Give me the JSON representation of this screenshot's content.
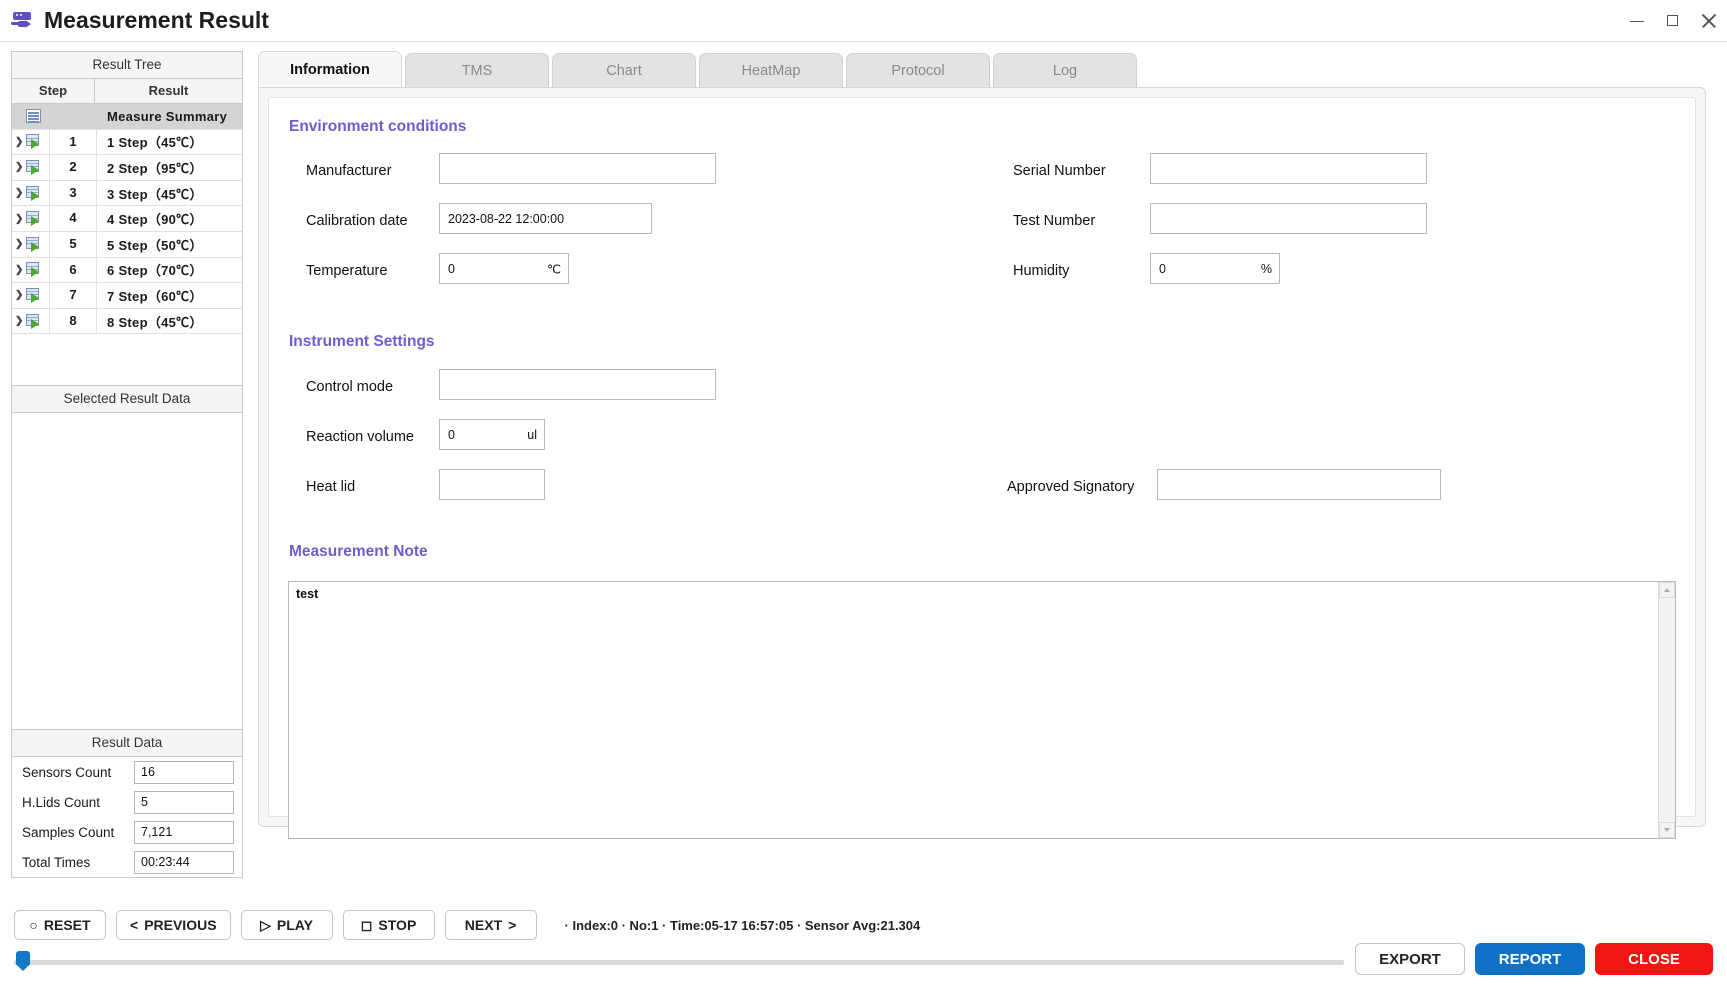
{
  "window": {
    "title": "Measurement Result",
    "icon": "server-transfer-icon",
    "controls": {
      "minimize": "minimize-icon",
      "maximize": "maximize-icon",
      "close": "close-icon"
    }
  },
  "left_panel": {
    "tree_header": "Result Tree",
    "columns": {
      "step": "Step",
      "result": "Result"
    },
    "rows": [
      {
        "step": "",
        "result": "Measure Summary",
        "icon": "summary-icon",
        "selected": true
      },
      {
        "step": "1",
        "result": "1 Step（45℃）",
        "icon": "step-icon",
        "selected": false
      },
      {
        "step": "2",
        "result": "2 Step（95℃）",
        "icon": "step-icon",
        "selected": false
      },
      {
        "step": "3",
        "result": "3 Step（45℃）",
        "icon": "step-icon",
        "selected": false
      },
      {
        "step": "4",
        "result": "4 Step（90℃）",
        "icon": "step-icon",
        "selected": false
      },
      {
        "step": "5",
        "result": "5 Step（50℃）",
        "icon": "step-icon",
        "selected": false
      },
      {
        "step": "6",
        "result": "6 Step（70℃）",
        "icon": "step-icon",
        "selected": false
      },
      {
        "step": "7",
        "result": "7 Step（60℃）",
        "icon": "step-icon",
        "selected": false
      },
      {
        "step": "8",
        "result": "8 Step（45℃）",
        "icon": "step-icon",
        "selected": false
      }
    ],
    "selected_result_header": "Selected Result Data",
    "result_data_header": "Result Data",
    "result_data": [
      {
        "label": "Sensors Count",
        "value": "16"
      },
      {
        "label": "H.Lids Count",
        "value": "5"
      },
      {
        "label": "Samples Count",
        "value": "7,121"
      },
      {
        "label": "Total Times",
        "value": "00:23:44"
      }
    ]
  },
  "tabs": [
    {
      "label": "Information",
      "active": true
    },
    {
      "label": "TMS",
      "active": false
    },
    {
      "label": "Chart",
      "active": false
    },
    {
      "label": "HeatMap",
      "active": false
    },
    {
      "label": "Protocol",
      "active": false
    },
    {
      "label": "Log",
      "active": false
    }
  ],
  "information": {
    "environment_title": "Environment conditions",
    "manufacturer_label": "Manufacturer",
    "manufacturer_value": "",
    "calibration_label": "Calibration date",
    "calibration_value": "2023-08-22  12:00:00",
    "temperature_label": "Temperature",
    "temperature_value": "0",
    "temperature_unit": "℃",
    "serial_label": "Serial Number",
    "serial_value": "",
    "test_number_label": "Test Number",
    "test_number_value": "",
    "humidity_label": "Humidity",
    "humidity_value": "0",
    "humidity_unit": "%",
    "instrument_title": "Instrument Settings",
    "control_mode_label": "Control mode",
    "control_mode_value": "",
    "reaction_volume_label": "Reaction volume",
    "reaction_volume_value": "0",
    "reaction_volume_unit": "ul",
    "heat_lid_label": "Heat lid",
    "heat_lid_value": "",
    "approved_signatory_label": "Approved Signatory",
    "approved_signatory_value": "",
    "note_title": "Measurement Note",
    "note_value": "test"
  },
  "bottom": {
    "buttons": [
      {
        "icon": "circle-icon",
        "label": "RESET"
      },
      {
        "icon": "left-chevron-icon",
        "label": "PREVIOUS"
      },
      {
        "icon": "play-triangle-icon",
        "label": "PLAY"
      },
      {
        "icon": "square-icon",
        "label": "STOP"
      },
      {
        "icon": "right-chevron-icon",
        "label": "NEXT"
      }
    ],
    "status": "· Index:0 · No:1 · Time:05-17 16:57:05 · Sensor Avg:21.304",
    "export_label": "EXPORT",
    "report_label": "REPORT",
    "close_label": "CLOSE",
    "slider_position_percent": 0
  },
  "colors": {
    "accent_purple": "#6a5fd0",
    "report_blue": "#0d71c7",
    "close_red": "#f31414",
    "slider_blue": "#1278c8"
  }
}
